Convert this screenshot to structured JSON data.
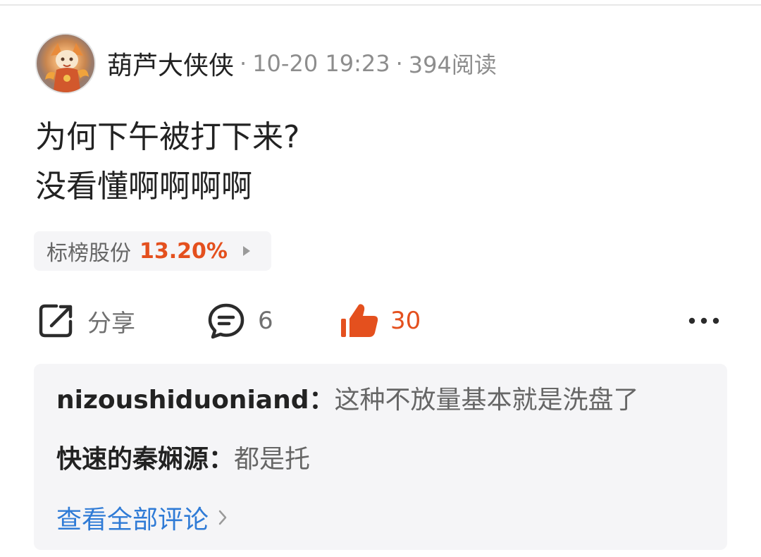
{
  "post": {
    "author": "葫芦大侠侠",
    "separator": "·",
    "time": "10-20 19:23",
    "reads": "394阅读",
    "lines": [
      "为何下午被打下来?",
      "没看懂啊啊啊啊"
    ]
  },
  "stock_tag": {
    "name": "标榜股份",
    "change": "13.20%",
    "change_color": "#e4501e"
  },
  "actions": {
    "share_label": "分享",
    "comment_count": "6",
    "like_count": "30",
    "like_color": "#e4501e",
    "icons": {
      "share": "share-icon",
      "comment": "comment-icon",
      "like": "thumbs-up-icon",
      "more": "more-icon"
    }
  },
  "comments": [
    {
      "author": "nizoushiduoniand：",
      "text": "这种不放量基本就是洗盘了"
    },
    {
      "author": "快速的秦娴源：",
      "text": "都是托"
    }
  ],
  "view_all_comments": "查看全部评论",
  "colors": {
    "link": "#2f7bd6",
    "card_background": "#f5f5f7"
  }
}
